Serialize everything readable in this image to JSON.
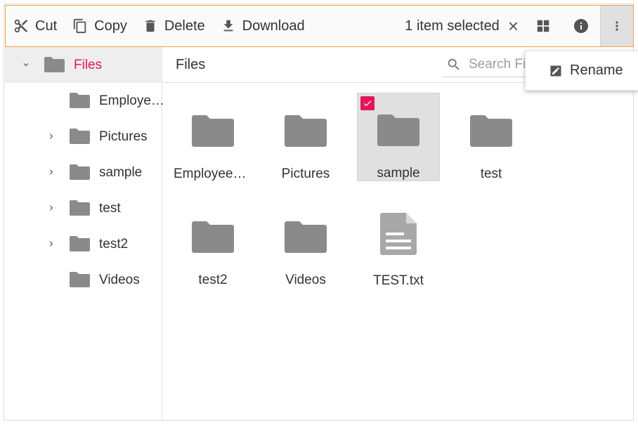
{
  "toolbar": {
    "cut_label": "Cut",
    "copy_label": "Copy",
    "delete_label": "Delete",
    "download_label": "Download",
    "selection_text": "1 item selected",
    "clear_icon": "×"
  },
  "navigation": {
    "root": "Files",
    "items": [
      {
        "label": "Employe…",
        "expandable": false
      },
      {
        "label": "Pictures",
        "expandable": true
      },
      {
        "label": "sample",
        "expandable": true
      },
      {
        "label": "test",
        "expandable": true
      },
      {
        "label": "test2",
        "expandable": true
      },
      {
        "label": "Videos",
        "expandable": false
      }
    ]
  },
  "breadcrumb": {
    "current": "Files"
  },
  "search": {
    "placeholder": "Search Files"
  },
  "files": [
    {
      "name": "Employees…",
      "type": "folder",
      "selected": false
    },
    {
      "name": "Pictures",
      "type": "folder",
      "selected": false
    },
    {
      "name": "sample",
      "type": "folder",
      "selected": true
    },
    {
      "name": "test",
      "type": "folder",
      "selected": false
    },
    {
      "name": "test2",
      "type": "folder",
      "selected": false
    },
    {
      "name": "Videos",
      "type": "folder",
      "selected": false
    },
    {
      "name": "TEST.txt",
      "type": "file",
      "selected": false
    }
  ],
  "context_menu": {
    "rename_label": "Rename"
  },
  "colors": {
    "accent": "#e3165b",
    "folder": "#8a8a8a",
    "toolbar_border": "#f0a040",
    "selected_bg": "#e0e0e0"
  }
}
